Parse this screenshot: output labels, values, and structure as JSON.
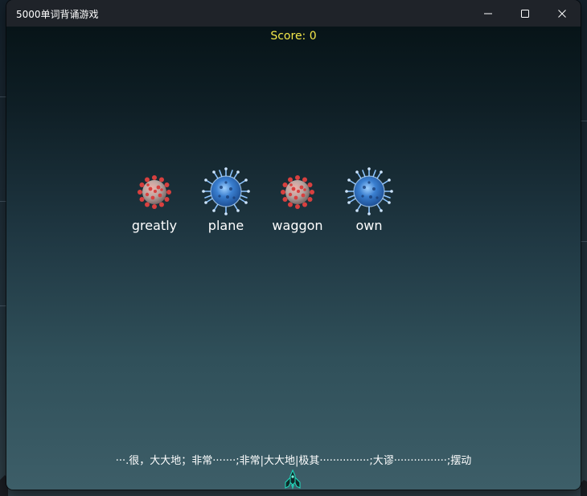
{
  "window": {
    "title": "5000单词背诵游戏",
    "controls": {
      "minimize_icon": "minimize-icon",
      "maximize_icon": "maximize-icon",
      "close_icon": "close-icon"
    }
  },
  "game": {
    "score_label": "Score: 0",
    "enemies": [
      {
        "word": "greatly",
        "virus_type": "red-virus"
      },
      {
        "word": "plane",
        "virus_type": "blue-virus"
      },
      {
        "word": "waggon",
        "virus_type": "red-virus"
      },
      {
        "word": "own",
        "virus_type": "blue-virus"
      }
    ],
    "definition_prompt": "···.很，大大地；非常·······;非常|大大地|极其···············;大谬················;摆动",
    "player_icon": "spaceship-icon"
  },
  "colors": {
    "score": "#f4e84a",
    "titlebar": "#1f2329",
    "word_text": "#ffffff",
    "red_virus": "#d94b4b",
    "blue_virus": "#3a7fd0"
  }
}
